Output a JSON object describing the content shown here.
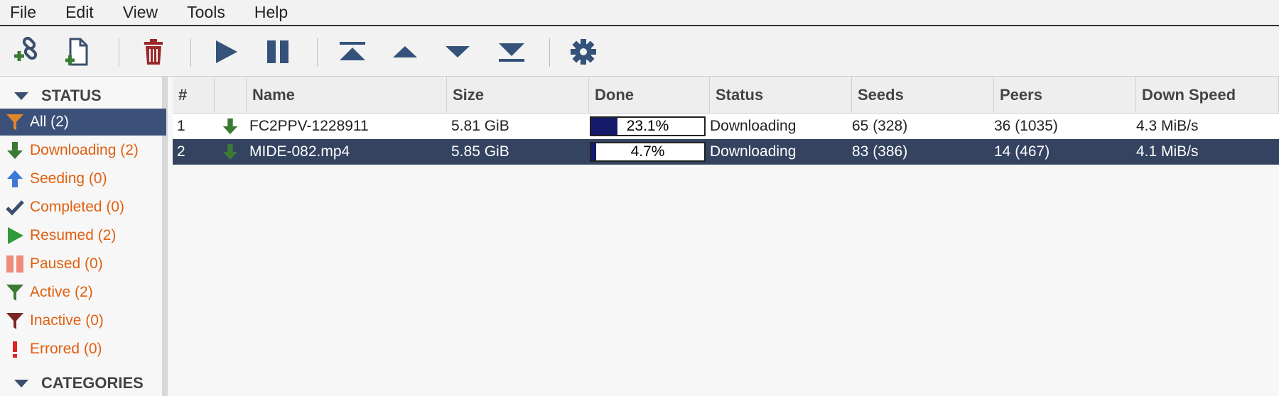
{
  "menu": [
    "File",
    "Edit",
    "View",
    "Tools",
    "Help"
  ],
  "toolbar": {
    "buttons": [
      "add-torrent-url",
      "add-torrent-file",
      "delete",
      "resume",
      "pause",
      "move-top",
      "move-up",
      "move-down",
      "move-bottom",
      "settings"
    ]
  },
  "sidebar": {
    "status_header": "STATUS",
    "categories_header": "CATEGORIES",
    "items": [
      {
        "label": "All (2)",
        "icon": "filter-icon",
        "color": "#e0852a"
      },
      {
        "label": "Downloading (2)",
        "icon": "arrow-down-icon",
        "color": "#3a7a35"
      },
      {
        "label": "Seeding (0)",
        "icon": "arrow-up-icon",
        "color": "#3c78d8"
      },
      {
        "label": "Completed (0)",
        "icon": "check-icon",
        "color": "#3b4f6e"
      },
      {
        "label": "Resumed (2)",
        "icon": "play-icon",
        "color": "#2e9a3a"
      },
      {
        "label": "Paused (0)",
        "icon": "pause-icon",
        "color": "#f08a7a"
      },
      {
        "label": "Active (2)",
        "icon": "filter-icon",
        "color": "#3a7a35"
      },
      {
        "label": "Inactive (0)",
        "icon": "filter-icon",
        "color": "#7a2626"
      },
      {
        "label": "Errored (0)",
        "icon": "exclamation-icon",
        "color": "#e02020"
      }
    ]
  },
  "table": {
    "columns": [
      "#",
      "",
      "Name",
      "Size",
      "Done",
      "Status",
      "Seeds",
      "Peers",
      "Down Speed"
    ],
    "rows": [
      {
        "num": "1",
        "name": "FC2PPV-1228911",
        "size": "5.81 GiB",
        "done": "23.1%",
        "progress": 0.231,
        "status": "Downloading",
        "seeds": "65 (328)",
        "peers": "36 (1035)",
        "down": "4.3 MiB/s"
      },
      {
        "num": "2",
        "name": "MIDE-082.mp4",
        "size": "5.85 GiB",
        "done": "4.7%",
        "progress": 0.047,
        "status": "Downloading",
        "seeds": "83 (386)",
        "peers": "14 (467)",
        "down": "4.1 MiB/s"
      }
    ]
  }
}
